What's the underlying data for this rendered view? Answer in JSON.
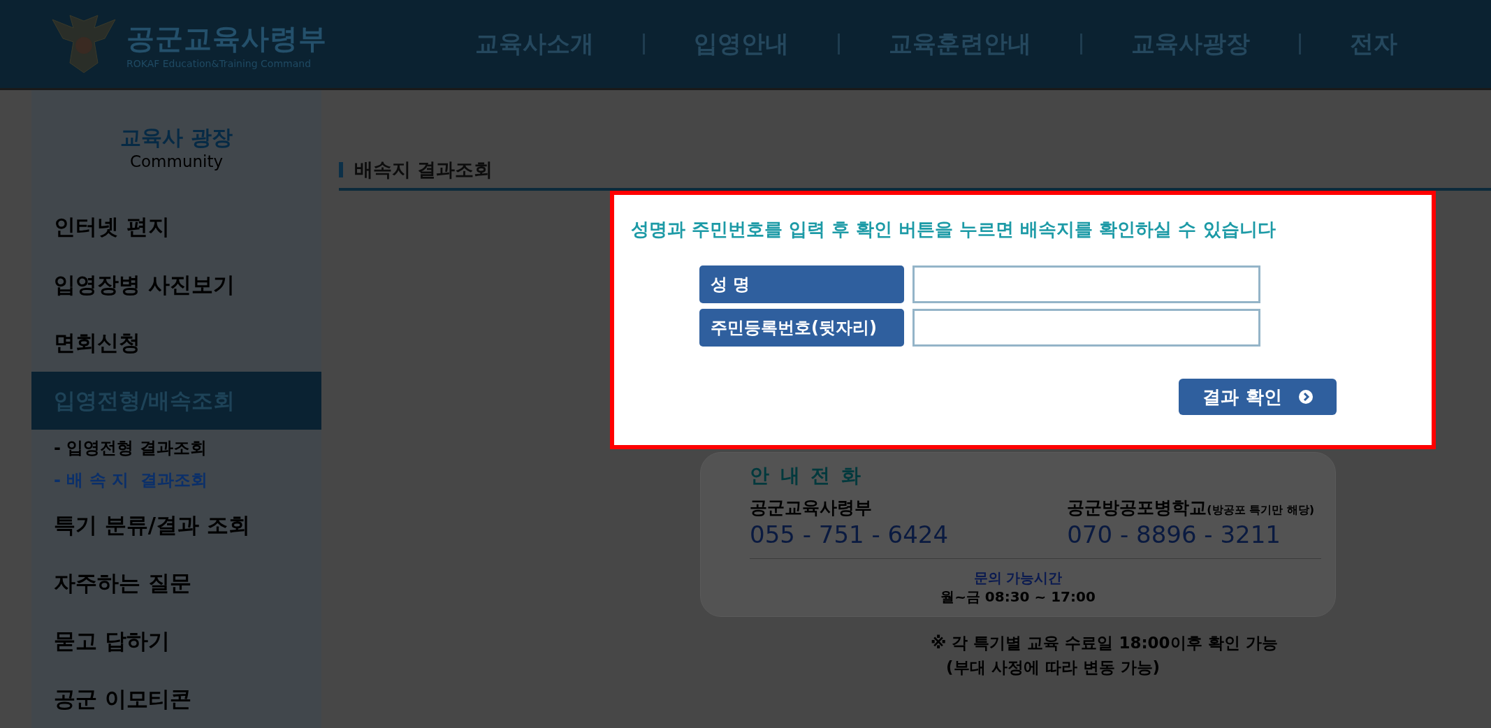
{
  "header": {
    "logo": {
      "title": "공군교육사령부",
      "subtitle": "ROKAF Education&Training Command"
    },
    "nav": [
      "교육사소개",
      "입영안내",
      "교육훈련안내",
      "교육사광장",
      "전자"
    ]
  },
  "sidebar": {
    "title": "교육사 광장",
    "subtitle": "Community",
    "items": [
      {
        "label": "인터넷 편지",
        "selected": false
      },
      {
        "label": "입영장병 사진보기",
        "selected": false
      },
      {
        "label": "면회신청",
        "selected": false
      },
      {
        "label": "입영전형/배속조회",
        "selected": true,
        "children": [
          {
            "label": "- 입영전형 결과조회",
            "selected": false
          },
          {
            "label": "- 배 속 지  결과조회",
            "selected": true
          }
        ]
      },
      {
        "label": "특기 분류/결과 조회",
        "selected": false
      },
      {
        "label": "자주하는 질문",
        "selected": false
      },
      {
        "label": "묻고 답하기",
        "selected": false
      },
      {
        "label": "공군 이모티콘",
        "selected": false
      }
    ]
  },
  "page_title": "배속지 결과조회",
  "form": {
    "message": "성명과 주민번호를 입력 후 확인 버튼을 누르면 배속지를 확인하실 수 있습니다",
    "fields": [
      {
        "label": "성 명"
      },
      {
        "label": "주민등록번호(뒷자리)"
      }
    ],
    "button": "결과 확인"
  },
  "contact": {
    "title": "안 내 전 화",
    "entries": [
      {
        "name": "공군교육사령부",
        "phone": "055 - 751 - 6424"
      },
      {
        "name": "공군방공포병학교",
        "note": "(방공포 특기만 해당)",
        "phone": "070 - 8896 - 3211"
      }
    ],
    "hours_title": "문의 가능시간",
    "hours": "월~금 08:30 ~ 17:00"
  },
  "notes": [
    "※ 각 특기별 교육 수료일 18:00이후 확인 가능",
    "(부대 사정에 따라 변동 가능)"
  ]
}
